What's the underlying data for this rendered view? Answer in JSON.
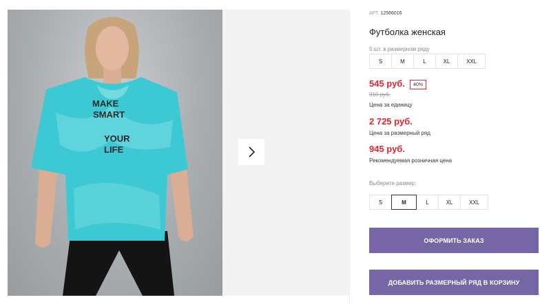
{
  "gallery": {
    "photo_alt": "Model wearing turquoise tie-dye t-shirt",
    "shirt_print": [
      "MAKE",
      "SMART",
      "YOUR",
      "LIFE"
    ],
    "next_icon": "chevron-right-icon"
  },
  "product": {
    "article_label": "АРТ.",
    "article_number": "12566016",
    "title": "Футболка женская",
    "row_note": "5 шт. в размерном ряду",
    "row_sizes": [
      "S",
      "M",
      "L",
      "XL",
      "XXL"
    ],
    "unit_price": "545 руб.",
    "discount_badge": "40%",
    "old_price": "910 руб.",
    "unit_price_caption": "Цена за единицу",
    "row_price": "2 725 руб.",
    "row_price_caption": "Цена за размерный ряд",
    "retail_price": "945 руб.",
    "retail_price_caption": "Рекомендуемая розничная цена",
    "choose_size_label": "Выберите размер:",
    "size_options": [
      "S",
      "M",
      "L",
      "XL",
      "XXL"
    ],
    "selected_size": "M",
    "order_button": "ОФОРМИТЬ ЗАКАЗ",
    "add_row_button": "ДОБАВИТЬ РАЗМЕРНЫЙ РЯД В КОРЗИНУ"
  },
  "colors": {
    "price_red": "#e3232f",
    "button_purple": "#7766a5",
    "shirt_turquoise": "#3cc9d3"
  }
}
